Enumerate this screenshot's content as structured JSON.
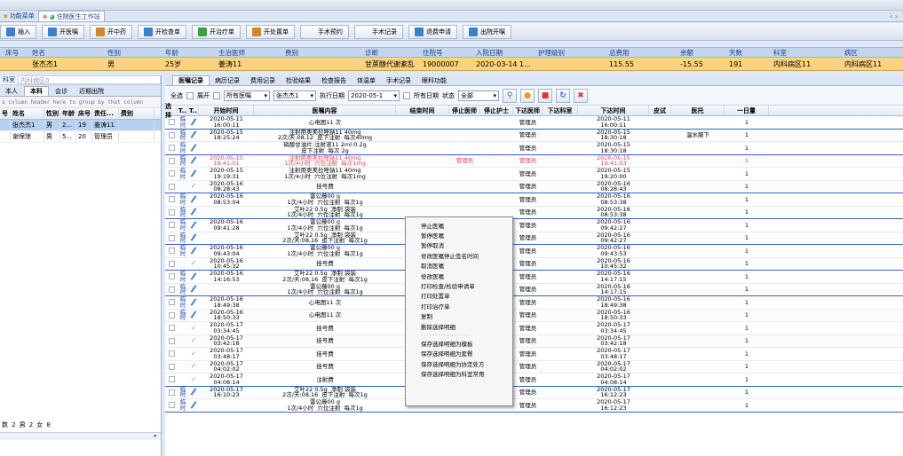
{
  "window_tabs": [
    {
      "label": "功能菜单",
      "active": false
    },
    {
      "label": "住院医生工作站",
      "active": true
    }
  ],
  "toolbar": [
    "插入",
    "开医嘱",
    "开中药",
    "开检查单",
    "开治疗单",
    "开处置单",
    "手术预约",
    "手术记录",
    "退费申请",
    "出院开嘱"
  ],
  "patient_header": [
    "床号",
    "姓名",
    "性别",
    "年龄",
    "主治医师",
    "费别",
    "诊断",
    "住院号",
    "入院日期",
    "护理级别",
    "总费用",
    "余额",
    "天数",
    "科室",
    "病区"
  ],
  "patient_row": [
    "",
    "张杰杰1",
    "男",
    "25岁",
    "姜涛11",
    "",
    "甘蔗醇代谢紊乱",
    "19000007",
    "2020-03-14 1...",
    "",
    "115.55",
    "-15.55",
    "191",
    "内科病区11",
    "内科病区11"
  ],
  "left": {
    "search": [
      "科室",
      "内科病区0"
    ],
    "tabs": [
      "本人",
      "本科",
      "会诊",
      "近期出院"
    ],
    "group_hint": "a column header here to group by that column",
    "columns": [
      "号",
      "姓名",
      "性别",
      "年龄",
      "床号",
      "责任...",
      "费别"
    ],
    "rows": [
      [
        "",
        "张杰杰1",
        "男",
        "2...",
        "19",
        "姜涛11",
        ""
      ],
      [
        "",
        "谢保琼",
        "男",
        "5...",
        "20",
        "管理员",
        ""
      ]
    ],
    "footer": "数 2 男 2 女 0"
  },
  "right": {
    "tabs": [
      "医嘱记录",
      "病历记录",
      "费用记录",
      "检验结果",
      "检查报告",
      "体温单",
      "手术记录",
      "眼科功能"
    ],
    "filter": {
      "select_all": "全选",
      "expand": "展开",
      "doctor": "所有医嘱",
      "patient": "张杰杰1",
      "exec_date_label": "执行日期",
      "exec_date": "2020-05-1",
      "all_dates": "所有日期",
      "status_label": "状态",
      "status": "全部"
    },
    "columns": [
      "选择",
      "T..",
      "T..",
      "开始时间",
      "医嘱内容",
      "结束时间",
      "停止医师",
      "停止护士",
      "下达医师",
      "下达科室",
      "下达时间",
      "皮试",
      "医托",
      "一日量"
    ],
    "orders": [
      {
        "type": "临\n时",
        "start": "2020-05-11\n16:00:11",
        "content": "心电图11 次",
        "end": "",
        "stopdoc": "",
        "issuer": "管理员",
        "time": "2020-05-11\n16:00:11",
        "note": "",
        "qty": "1",
        "stopped": false,
        "sep": true
      },
      {
        "type": "临\n时",
        "start": "2020-05-15\n18:25:24",
        "content": "注射用奥美拉唑钠11 40mg\n2次/天:08,12  皮下注射  每次40mg",
        "end": "",
        "stopdoc": "",
        "issuer": "管理员",
        "time": "2020-05-15\n18:30:18",
        "note": "温水服下",
        "qty": "1",
        "stopped": false,
        "sep": false
      },
      {
        "type": "临\n时",
        "start": "",
        "content": "硝酸甘油片:注射液11 2ml:0.2g\n皮下注射  每次 2g",
        "end": "",
        "stopdoc": "",
        "issuer": "管理员",
        "time": "2020-05-15\n18:30:18",
        "note": "",
        "qty": "1",
        "stopped": false,
        "sep": true
      },
      {
        "type": "临\n时",
        "start": "2020-05-15\n19:41:01",
        "content": "注射用奥美拉唑钠11 40mg\n1次/4小时  穴位注射  每次1mg",
        "end": "",
        "stopdoc": "管理员",
        "issuer": "管理员",
        "time": "2020-05-15\n19:41:03",
        "note": "",
        "qty": "1",
        "stopped": true,
        "sep": false
      },
      {
        "type": "临\n时",
        "start": "2020-05-15\n19:19:31",
        "content": "注射用奥美拉唑钠11 40mg\n1次/4小时  穴位注射  每次1mg",
        "end": "",
        "stopdoc": "",
        "issuer": "管理员",
        "time": "2020-05-15\n19:20:00",
        "note": "",
        "qty": "1",
        "stopped": false,
        "sep": false
      },
      {
        "type": "",
        "start": "2020-05-16\n08:28:43",
        "content": "挂号费",
        "end": "",
        "stopdoc": "",
        "issuer": "管理员",
        "time": "2020-05-16\n08:28:43",
        "note": "",
        "qty": "1",
        "stopped": false,
        "sep": true
      },
      {
        "type": "临\n时",
        "start": "2020-05-16\n08:53:04",
        "content": "雷公藤00 g\n1次/4小时  穴位注射  每次1g",
        "end": "",
        "stopdoc": "",
        "issuer": "管理员",
        "time": "2020-05-16\n08:53:38",
        "note": "",
        "qty": "1",
        "stopped": false,
        "sep": false
      },
      {
        "type": "临\n时",
        "start": "",
        "content": "艾叶22 0.5g  净制 袋装\n1次/4小时  穴位注射  每次1g",
        "end": "",
        "stopdoc": "",
        "issuer": "管理员",
        "time": "2020-05-16\n08:53:38",
        "note": "",
        "qty": "1",
        "stopped": false,
        "sep": true
      },
      {
        "type": "临\n时",
        "start": "2020-05-16\n09:41:28",
        "content": "雷公藤00 g\n1次/4小时  穴位注射  每次1g",
        "end": "",
        "stopdoc": "",
        "issuer": "管理员",
        "time": "2020-05-16\n09:42:27",
        "note": "",
        "qty": "1",
        "stopped": false,
        "sep": false
      },
      {
        "type": "临\n时",
        "start": "",
        "content": "艾叶22 0.5g  净制 袋装\n2次/天:08,16  皮下注射  每次1g",
        "end": "",
        "stopdoc": "",
        "issuer": "管理员",
        "time": "2020-05-16\n09:42:27",
        "note": "",
        "qty": "1",
        "stopped": false,
        "sep": true
      },
      {
        "type": "临\n时",
        "start": "2020-05-16\n09:43:04",
        "content": "雷公藤00 g\n1次/4小时  穴位注射  每次1g",
        "end": "",
        "stopdoc": "",
        "issuer": "管理员",
        "time": "2020-05-16\n09:43:53",
        "note": "",
        "qty": "1",
        "stopped": false,
        "sep": false
      },
      {
        "type": "",
        "start": "2020-05-16\n10:45:32",
        "content": "挂号费",
        "end": "",
        "stopdoc": "",
        "issuer": "管理员",
        "time": "2020-05-16\n10:45:32",
        "note": "",
        "qty": "1",
        "stopped": false,
        "sep": true
      },
      {
        "type": "临\n时",
        "start": "2020-05-16\n14:16:53",
        "content": "艾叶22 0.5g  净制 袋装\n2次/天:08,16  皮下注射  每次1g",
        "end": "",
        "stopdoc": "",
        "issuer": "管理员",
        "time": "2020-05-16\n14:17:15",
        "note": "",
        "qty": "1",
        "stopped": false,
        "sep": false
      },
      {
        "type": "临\n时",
        "start": "",
        "content": "雷公藤00 g\n1次/4小时  穴位注射  每次1g",
        "end": "",
        "stopdoc": "",
        "issuer": "管理员",
        "time": "2020-05-16\n14:17:15",
        "note": "",
        "qty": "1",
        "stopped": false,
        "sep": true
      },
      {
        "type": "临\n时",
        "start": "2020-05-16\n18:49:38",
        "content": "心电图11 次",
        "end": "",
        "stopdoc": "",
        "issuer": "管理员",
        "time": "2020-05-16\n18:49:38",
        "note": "",
        "qty": "1",
        "stopped": false,
        "sep": false
      },
      {
        "type": "临\n时",
        "start": "2020-05-16\n18:50:33",
        "content": "心电图11 次",
        "end": "",
        "stopdoc": "",
        "issuer": "管理员",
        "time": "2020-05-16\n18:50:33",
        "note": "",
        "qty": "1",
        "stopped": false,
        "sep": false
      },
      {
        "type": "",
        "start": "2020-05-17\n03:34:45",
        "content": "挂号费",
        "end": "",
        "stopdoc": "",
        "issuer": "管理员",
        "time": "2020-05-17\n03:34:45",
        "note": "",
        "qty": "1",
        "stopped": false,
        "sep": false
      },
      {
        "type": "",
        "start": "2020-05-17\n03:42:18",
        "content": "挂号费",
        "end": "",
        "stopdoc": "",
        "issuer": "管理员",
        "time": "2020-05-17\n03:42:18",
        "note": "",
        "qty": "1",
        "stopped": false,
        "sep": false
      },
      {
        "type": "",
        "start": "2020-05-17\n03:48:17",
        "content": "挂号费",
        "end": "",
        "stopdoc": "",
        "issuer": "管理员",
        "time": "2020-05-17\n03:48:17",
        "note": "",
        "qty": "1",
        "stopped": false,
        "sep": false
      },
      {
        "type": "",
        "start": "2020-05-17\n04:02:02",
        "content": "挂号费",
        "end": "",
        "stopdoc": "",
        "issuer": "管理员",
        "time": "2020-05-17\n04:02:02",
        "note": "",
        "qty": "1",
        "stopped": false,
        "sep": false
      },
      {
        "type": "",
        "start": "2020-05-17\n04:08:14",
        "content": "注射费",
        "end": "",
        "stopdoc": "",
        "issuer": "管理员",
        "time": "2020-05-17\n04:08:14",
        "note": "",
        "qty": "1",
        "stopped": false,
        "sep": true
      },
      {
        "type": "临\n时",
        "start": "2020-05-17\n16:10:23",
        "content": "艾叶22 0.5g  净制 袋装\n2次/天:08,16  皮下注射  每次1g",
        "end": "",
        "stopdoc": "",
        "issuer": "管理员",
        "time": "2020-05-17\n16:12:23",
        "note": "",
        "qty": "1",
        "stopped": false,
        "sep": false
      },
      {
        "type": "临\n时",
        "start": "",
        "content": "雷公藤00 g\n1次/4小时  穴位注射  每次1g",
        "end": "",
        "stopdoc": "",
        "issuer": "管理员",
        "time": "2020-05-17\n16:12:23",
        "note": "",
        "qty": "1",
        "stopped": false,
        "sep": true
      }
    ]
  },
  "context_menu": [
    "停止医嘱",
    "暂停医嘱",
    "暂停取消",
    "修改医嘱停止签名时间",
    "取消医嘱",
    "修改医嘱",
    "打印检查/检验申请单",
    "打印处置单",
    "打印治疗单",
    "复制",
    "删除选择明细",
    "------------------",
    "保存选择明细为模板",
    "保存选择明细为套餐",
    "保存选择明细为协定处方",
    "保存选择明细为科室常用"
  ],
  "colors": {
    "selected_row": "#fbd37a",
    "stopped": "#e05050",
    "accent": "#15428b"
  }
}
